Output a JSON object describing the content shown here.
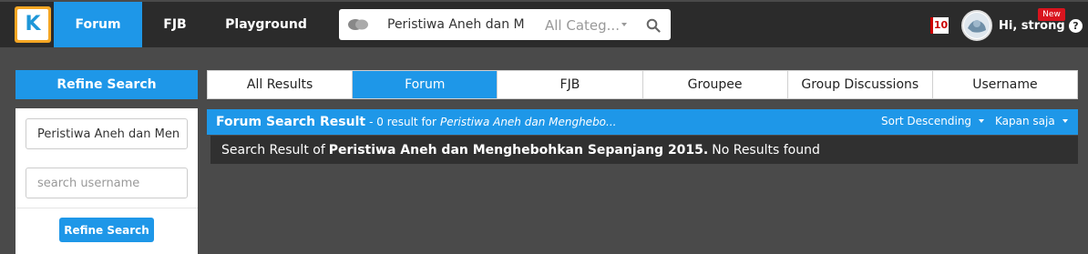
{
  "header": {
    "logo_letter": "K",
    "nav": {
      "forum": "Forum",
      "fjb": "FJB",
      "playground": "Playground"
    },
    "search": {
      "value": "Peristiwa Aneh dan Me",
      "category": "All Categ..."
    },
    "notification_count": "10",
    "new_badge": "New",
    "greeting": "Hi, strong",
    "help": "?"
  },
  "sidebar": {
    "title": "Refine Search",
    "keyword_value": "Peristiwa Aneh dan Men",
    "username_placeholder": "search username",
    "button": "Refine Search"
  },
  "tabs": [
    "All Results",
    "Forum",
    "FJB",
    "Groupee",
    "Group Discussions",
    "Username"
  ],
  "active_tab": "Forum",
  "results": {
    "title": "Forum Search Result",
    "count_text": "- 0 result for",
    "keyword_short": "Peristiwa Aneh dan Menghebo...",
    "sort": "Sort Descending",
    "time": "Kapan saja",
    "message_prefix": "Search Result of",
    "message_keyword": "Peristiwa Aneh dan Menghebohkan Sepanjang 2015.",
    "message_suffix": "No Results found"
  },
  "colors": {
    "accent": "#1e97e8",
    "topbar": "#2b2b2b",
    "background": "#4a4a4a",
    "logo": "#f5a623",
    "badge": "#d9141e"
  }
}
